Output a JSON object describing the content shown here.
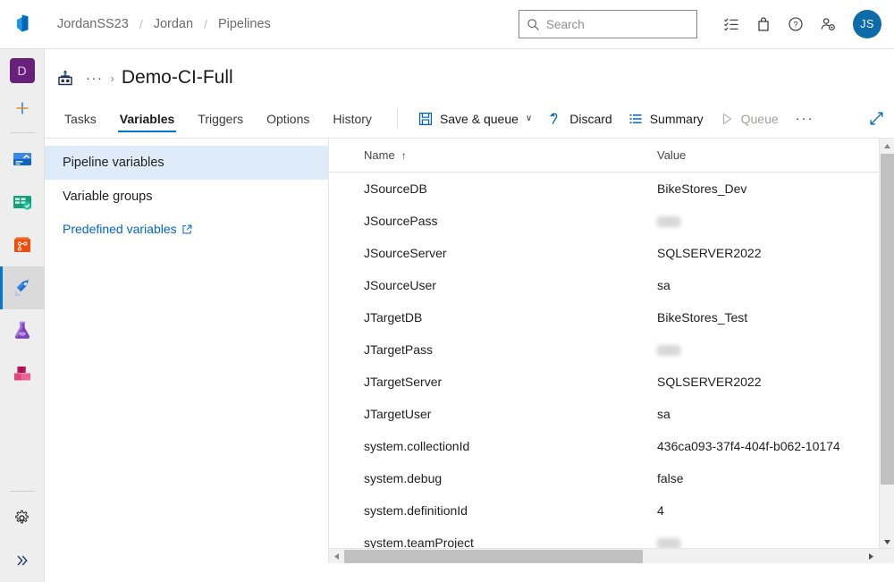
{
  "topbar": {
    "logo_icon": "azure-devops-logo",
    "breadcrumb": [
      {
        "label": "JordanSS23"
      },
      {
        "label": "Jordan"
      },
      {
        "label": "Pipelines"
      }
    ],
    "separator": "/",
    "search": {
      "placeholder": "Search",
      "value": "",
      "icon": "search-icon"
    },
    "actions": [
      {
        "name": "tasks-icon",
        "title": "Tasks"
      },
      {
        "name": "marketplace-icon",
        "title": "Marketplace"
      },
      {
        "name": "help-icon",
        "title": "Help"
      },
      {
        "name": "user-settings-icon",
        "title": "User settings"
      }
    ],
    "avatar": {
      "initials": "JS",
      "color": "#0d6ba8"
    }
  },
  "rail": {
    "project_avatar": {
      "initials": "D",
      "color": "#68217a"
    },
    "new_label": "+",
    "items": [
      {
        "name": "overview",
        "label": "Overview",
        "selected": false
      },
      {
        "name": "boards",
        "label": "Boards",
        "selected": false
      },
      {
        "name": "repos",
        "label": "Repos",
        "selected": false
      },
      {
        "name": "pipelines",
        "label": "Pipelines",
        "selected": true
      },
      {
        "name": "test-plans",
        "label": "Test Plans",
        "selected": false
      },
      {
        "name": "artifacts",
        "label": "Artifacts",
        "selected": false
      }
    ],
    "bottom": [
      {
        "name": "project-settings",
        "label": "Project settings"
      },
      {
        "name": "expand-rail",
        "label": "Expand"
      }
    ],
    "accent_color": "#0078d4"
  },
  "pipeline_header": {
    "icon": "build-pipeline-icon",
    "ellipsis": "···",
    "chevron": "›",
    "title": "Demo-CI-Full"
  },
  "tabs": [
    {
      "label": "Tasks",
      "active": false
    },
    {
      "label": "Variables",
      "active": true
    },
    {
      "label": "Triggers",
      "active": false
    },
    {
      "label": "Options",
      "active": false
    },
    {
      "label": "History",
      "active": false
    }
  ],
  "toolbar": {
    "save_queue_label": "Save & queue",
    "save_queue_caret": "∨",
    "discard_label": "Discard",
    "summary_label": "Summary",
    "queue_label": "Queue",
    "more_label": "···",
    "expand_icon": "fullscreen-icon"
  },
  "left_pane": {
    "items": [
      {
        "label": "Pipeline variables",
        "selected": true
      },
      {
        "label": "Variable groups",
        "selected": false
      }
    ],
    "link": {
      "label": "Predefined variables",
      "icon": "external-link-icon"
    }
  },
  "grid": {
    "columns": [
      {
        "label": "Name",
        "sort": "↑"
      },
      {
        "label": "Value",
        "sort": ""
      }
    ],
    "rows": [
      {
        "name": "JSourceDB",
        "value": "BikeStores_Dev",
        "redacted": false
      },
      {
        "name": "JSourcePass",
        "value": "",
        "redacted": true
      },
      {
        "name": "JSourceServer",
        "value": "SQLSERVER2022",
        "redacted": false
      },
      {
        "name": "JSourceUser",
        "value": "sa",
        "redacted": false
      },
      {
        "name": "JTargetDB",
        "value": "BikeStores_Test",
        "redacted": false
      },
      {
        "name": "JTargetPass",
        "value": "",
        "redacted": true
      },
      {
        "name": "JTargetServer",
        "value": "SQLSERVER2022",
        "redacted": false
      },
      {
        "name": "JTargetUser",
        "value": "sa",
        "redacted": false
      },
      {
        "name": "system.collectionId",
        "value": "436ca093-37f4-404f-b062-10174",
        "redacted": false
      },
      {
        "name": "system.debug",
        "value": "false",
        "redacted": false
      },
      {
        "name": "system.definitionId",
        "value": "4",
        "redacted": false
      },
      {
        "name": "system.teamProject",
        "value": "",
        "redacted": true
      }
    ]
  },
  "scrollbars": {
    "vertical": {
      "up": "▲",
      "down": "▼"
    },
    "horizontal": {
      "left": "◀",
      "right": "▶"
    }
  }
}
